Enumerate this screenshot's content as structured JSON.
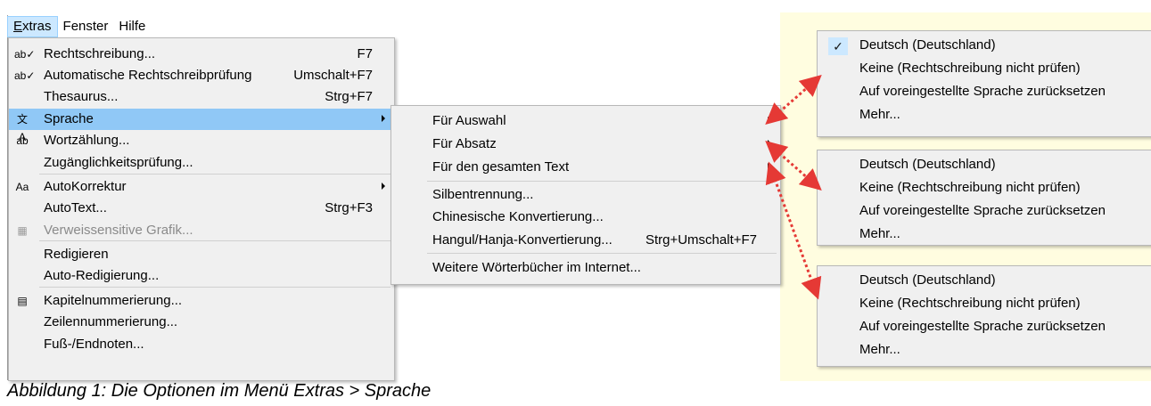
{
  "menubar": {
    "items": [
      {
        "label": "Extras",
        "active": true
      },
      {
        "label": "Fenster"
      },
      {
        "label": "Hilfe"
      }
    ]
  },
  "extras_menu": {
    "items": [
      {
        "label": "Rechtschreibung...",
        "shortcut": "F7",
        "icon": "spellcheck-icon"
      },
      {
        "label": "Automatische Rechtschreibprüfung",
        "shortcut": "Umschalt+F7",
        "icon": "auto-spellcheck-icon"
      },
      {
        "label": "Thesaurus...",
        "shortcut": "Strg+F7"
      },
      {
        "label": "Sprache",
        "submenu": true,
        "highlighted": true,
        "icon": "language-icon"
      },
      {
        "label": "Wortzählung...",
        "icon": "word-count-icon"
      },
      {
        "label": "Zugänglichkeitsprüfung..."
      },
      {
        "label": "AutoKorrektur",
        "submenu": true,
        "icon": "autocorrect-icon"
      },
      {
        "label": "AutoText...",
        "shortcut": "Strg+F3"
      },
      {
        "label": "Verweissensitive Grafik...",
        "disabled": true,
        "icon": "image-map-icon"
      },
      {
        "label": "Redigieren"
      },
      {
        "label": "Auto-Redigierung..."
      },
      {
        "label": "Kapitelnummerierung...",
        "icon": "chapter-numbering-icon"
      },
      {
        "label": "Zeilennummerierung..."
      },
      {
        "label": "Fuß-/Endnoten..."
      }
    ]
  },
  "sprache_menu": {
    "items": [
      {
        "label": "Für Auswahl",
        "submenu": true
      },
      {
        "label": "Für Absatz",
        "submenu": true
      },
      {
        "label": "Für den gesamten Text",
        "submenu": true
      },
      {
        "label": "Silbentrennung..."
      },
      {
        "label": "Chinesische Konvertierung..."
      },
      {
        "label": "Hangul/Hanja-Konvertierung...",
        "shortcut": "Strg+Umschalt+F7"
      },
      {
        "label": "Weitere Wörterbücher im Internet..."
      }
    ]
  },
  "language_submenus": [
    {
      "checked": true,
      "items": [
        "Deutsch (Deutschland)",
        "Keine (Rechtschreibung nicht prüfen)",
        "Auf voreingestellte Sprache zurücksetzen",
        "Mehr..."
      ]
    },
    {
      "checked": false,
      "items": [
        "Deutsch (Deutschland)",
        "Keine (Rechtschreibung nicht prüfen)",
        "Auf voreingestellte Sprache zurücksetzen",
        "Mehr..."
      ]
    },
    {
      "checked": false,
      "items": [
        "Deutsch (Deutschland)",
        "Keine (Rechtschreibung nicht prüfen)",
        "Auf voreingestellte Sprache zurücksetzen",
        "Mehr..."
      ]
    }
  ],
  "caption": "Abbildung 1: Die Optionen im Menü Extras > Sprache",
  "colors": {
    "highlight": "#90c8f6",
    "menu_bg": "#f0f0f0",
    "caption_bg": "#fffde0",
    "arrow": "#e53935"
  }
}
